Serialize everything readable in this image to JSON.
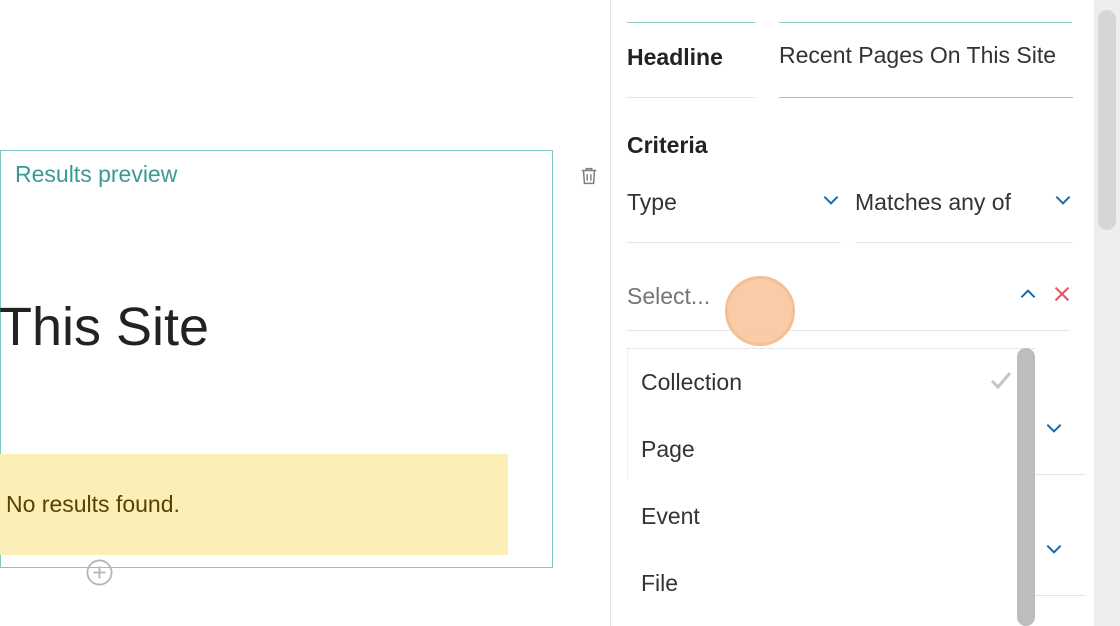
{
  "preview": {
    "title": "Results preview",
    "heading": "This Site",
    "no_results": "No results found."
  },
  "sidebar": {
    "headline_label": "Headline",
    "headline_value": "Recent Pages On This Site",
    "criteria_label": "Criteria",
    "field_select": {
      "label": "Type"
    },
    "operator_select": {
      "label": "Matches any of"
    },
    "value_select": {
      "placeholder": "Select..."
    },
    "dropdown_options": [
      {
        "label": "Collection",
        "checked": true
      },
      {
        "label": "Page",
        "checked": false
      },
      {
        "label": "Event",
        "checked": false
      },
      {
        "label": "File",
        "checked": false
      }
    ]
  },
  "icons": {
    "trash": "trash-icon",
    "add": "add-circle-icon",
    "chevron_down": "chevron-down-icon",
    "chevron_up": "chevron-up-icon",
    "close": "close-icon",
    "check": "check-icon"
  },
  "colors": {
    "accent_teal": "#7fc9c4",
    "link_blue": "#1469b3",
    "danger_red": "#e35665",
    "warning_bg": "#fbeeb7",
    "cursor_highlight": "#f7c79e"
  }
}
